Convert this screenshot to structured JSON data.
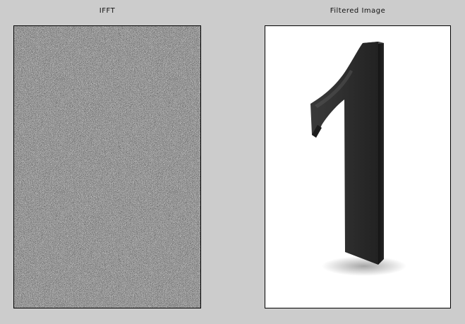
{
  "figure": {
    "left_panel": {
      "title": "IFFT",
      "content": "random-noise-image"
    },
    "right_panel": {
      "title": "Filtered Image",
      "content": "numeral-one-3d-image",
      "colors": {
        "background": "#ffffff",
        "numeral_face": "#2e2e2e",
        "numeral_side": "#1a1a1a"
      }
    },
    "window_background": "#cccccc"
  }
}
